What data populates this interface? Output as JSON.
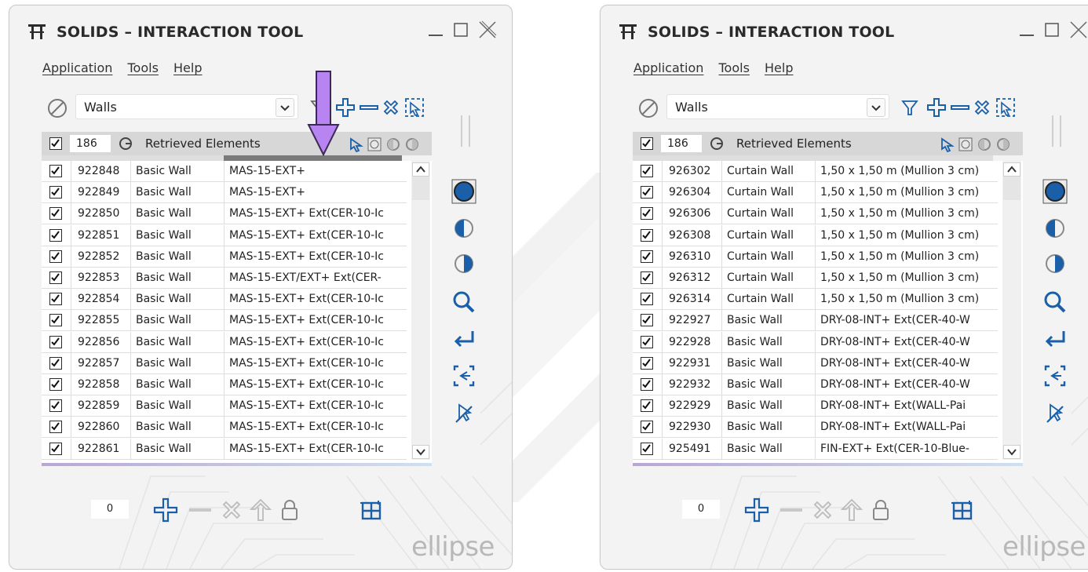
{
  "windows": [
    {
      "id": "left",
      "title": "SOLIDS – INTERACTION TOOL",
      "menu": [
        "Application",
        "Tools",
        "Help"
      ],
      "category_value": "Walls",
      "count": "186",
      "header_label": "Retrieved Elements",
      "rows": [
        {
          "id": "922848",
          "category": "Basic Wall",
          "type": "MAS-15-EXT+"
        },
        {
          "id": "922849",
          "category": "Basic Wall",
          "type": "MAS-15-EXT+"
        },
        {
          "id": "922850",
          "category": "Basic Wall",
          "type": "MAS-15-EXT+ Ext(CER-10-Ic"
        },
        {
          "id": "922851",
          "category": "Basic Wall",
          "type": "MAS-15-EXT+ Ext(CER-10-Ic"
        },
        {
          "id": "922852",
          "category": "Basic Wall",
          "type": "MAS-15-EXT+ Ext(CER-10-Ic"
        },
        {
          "id": "922853",
          "category": "Basic Wall",
          "type": "MAS-15-EXT/EXT+ Ext(CER-"
        },
        {
          "id": "922854",
          "category": "Basic Wall",
          "type": "MAS-15-EXT+ Ext(CER-10-Ic"
        },
        {
          "id": "922855",
          "category": "Basic Wall",
          "type": "MAS-15-EXT+ Ext(CER-10-Ic"
        },
        {
          "id": "922856",
          "category": "Basic Wall",
          "type": "MAS-15-EXT+ Ext(CER-10-Ic"
        },
        {
          "id": "922857",
          "category": "Basic Wall",
          "type": "MAS-15-EXT+ Ext(CER-10-Ic"
        },
        {
          "id": "922858",
          "category": "Basic Wall",
          "type": "MAS-15-EXT+ Ext(CER-10-Ic"
        },
        {
          "id": "922859",
          "category": "Basic Wall",
          "type": "MAS-15-EXT+ Ext(CER-10-Ic"
        },
        {
          "id": "922860",
          "category": "Basic Wall",
          "type": "MAS-15-EXT+ Ext(CER-10-Ic"
        },
        {
          "id": "922861",
          "category": "Basic Wall",
          "type": "MAS-15-EXT+ Ext(CER-10-Ic"
        }
      ],
      "bottom_value": "0",
      "brand": "ellipse"
    },
    {
      "id": "right",
      "title": "SOLIDS – INTERACTION TOOL",
      "menu": [
        "Application",
        "Tools",
        "Help"
      ],
      "category_value": "Walls",
      "count": "186",
      "header_label": "Retrieved Elements",
      "rows": [
        {
          "id": "926302",
          "category": "Curtain Wall",
          "type": "1,50 x 1,50 m (Mullion 3 cm)"
        },
        {
          "id": "926304",
          "category": "Curtain Wall",
          "type": "1,50 x 1,50 m (Mullion 3 cm)"
        },
        {
          "id": "926306",
          "category": "Curtain Wall",
          "type": "1,50 x 1,50 m (Mullion 3 cm)"
        },
        {
          "id": "926308",
          "category": "Curtain Wall",
          "type": "1,50 x 1,50 m (Mullion 3 cm)"
        },
        {
          "id": "926310",
          "category": "Curtain Wall",
          "type": "1,50 x 1,50 m (Mullion 3 cm)"
        },
        {
          "id": "926312",
          "category": "Curtain Wall",
          "type": "1,50 x 1,50 m (Mullion 3 cm)"
        },
        {
          "id": "926314",
          "category": "Curtain Wall",
          "type": "1,50 x 1,50 m (Mullion 3 cm)"
        },
        {
          "id": "922927",
          "category": "Basic Wall",
          "type": "DRY-08-INT+ Ext(CER-40-W"
        },
        {
          "id": "922928",
          "category": "Basic Wall",
          "type": "DRY-08-INT+ Ext(CER-40-W"
        },
        {
          "id": "922931",
          "category": "Basic Wall",
          "type": "DRY-08-INT+ Ext(CER-40-W"
        },
        {
          "id": "922932",
          "category": "Basic Wall",
          "type": "DRY-08-INT+ Ext(CER-40-W"
        },
        {
          "id": "922929",
          "category": "Basic Wall",
          "type": "DRY-08-INT+ Ext(WALL-Pai"
        },
        {
          "id": "922930",
          "category": "Basic Wall",
          "type": "DRY-08-INT+ Ext(WALL-Pai"
        },
        {
          "id": "925491",
          "category": "Basic Wall",
          "type": "FIN-EXT+ Ext(CER-10-Blue-"
        }
      ],
      "bottom_value": "0",
      "brand": "ellipse"
    }
  ],
  "colors": {
    "accent_blue": "#1a5fa8",
    "arrow_purple": "#b884f2",
    "grid_header": "#d7d7d7"
  },
  "icons": {
    "toolbar": [
      "no-filter-icon",
      "filter-icon",
      "plus-icon",
      "minus-icon",
      "cross-icon",
      "select-in-view-icon"
    ],
    "header": [
      "pointer-icon",
      "box-icon",
      "circle-icon",
      "half-circle-icon"
    ],
    "side": [
      "isolate-full-icon",
      "isolate-left-icon",
      "isolate-right-icon",
      "zoom-icon",
      "return-icon",
      "select-frame-icon",
      "pick-icon"
    ],
    "bottom": [
      "add-icon",
      "remove-icon",
      "clear-icon",
      "up-icon",
      "lock-icon",
      "section-box-icon"
    ]
  }
}
